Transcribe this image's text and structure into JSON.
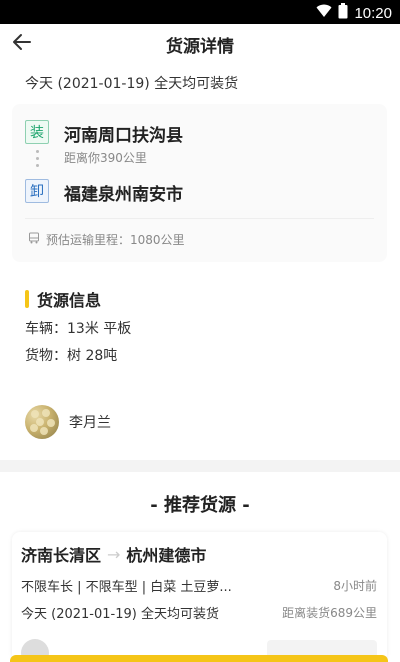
{
  "status_bar": {
    "time": "10:20",
    "icons": [
      "wifi-icon",
      "battery-icon"
    ]
  },
  "header": {
    "title": "货源详情",
    "back_icon": "arrow-left-icon"
  },
  "loading_date": "今天 (2021-01-19) 全天均可装货",
  "route": {
    "load_badge": "装",
    "from": "河南周口扶沟县",
    "distance": "距离你390公里",
    "unload_badge": "卸",
    "to": "福建泉州南安市",
    "mileage_icon": "truck-icon",
    "mileage": "预估运输里程：1080公里"
  },
  "cargo_info": {
    "section_title": "货源信息",
    "vehicle": "车辆：13米 平板",
    "goods": "货物：树 28吨"
  },
  "contact": {
    "name": "李月兰"
  },
  "recommend": {
    "title": "- 推荐货源 -",
    "items": [
      {
        "from": "济南长清区",
        "arrow": "→",
        "to": "杭州建德市",
        "tags": "不限车长 | 不限车型 | 白菜  土豆萝...",
        "time": "8小时前",
        "date": "今天 (2021-01-19) 全天均可装货",
        "distance": "距离装货689公里"
      }
    ]
  },
  "colors": {
    "accent": "#f5c518",
    "load_green": "#1aa36b",
    "unload_blue": "#2a6fbf"
  }
}
